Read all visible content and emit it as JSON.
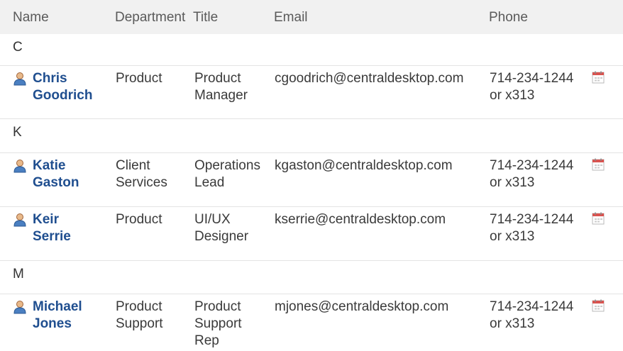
{
  "columns": {
    "name": "Name",
    "department": "Department",
    "title": "Title",
    "email": "Email",
    "phone": "Phone"
  },
  "groups": {
    "c": "C",
    "k": "K",
    "m": "M"
  },
  "contacts": [
    {
      "name_first": "Chris",
      "name_last": "Goodrich",
      "dept_1": "Product",
      "dept_2": "",
      "title_1": "Product",
      "title_2": "Manager",
      "title_3": "",
      "email": "cgoodrich@centraldesktop.com",
      "phone_1": "714-234-1244",
      "phone_2": "or x313"
    },
    {
      "name_first": "Katie",
      "name_last": "Gaston",
      "dept_1": "Client",
      "dept_2": "Services",
      "title_1": "Operations",
      "title_2": "Lead",
      "title_3": "",
      "email": "kgaston@centraldesktop.com",
      "phone_1": "714-234-1244",
      "phone_2": "or x313"
    },
    {
      "name_first": "Keir",
      "name_last": "Serrie",
      "dept_1": "Product",
      "dept_2": "",
      "title_1": "UI/UX",
      "title_2": "Designer",
      "title_3": "",
      "email": "kserrie@centraldesktop.com",
      "phone_1": "714-234-1244",
      "phone_2": "or x313"
    },
    {
      "name_first": "Michael",
      "name_last": "Jones",
      "dept_1": "Product",
      "dept_2": "Support",
      "title_1": "Product",
      "title_2": "Support",
      "title_3": "Rep",
      "email": "mjones@centraldesktop.com",
      "phone_1": "714-234-1244",
      "phone_2": "or x313"
    }
  ],
  "icons": {
    "person": "person-icon",
    "calendar": "calendar-icon"
  },
  "colors": {
    "link": "#1f4e8f",
    "header_bg": "#f1f1f1",
    "calendar_red": "#d9534f"
  }
}
